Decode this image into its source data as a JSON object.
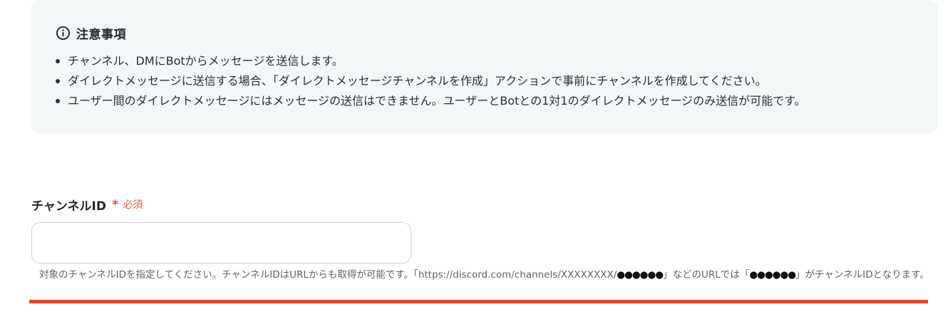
{
  "notice": {
    "title": "注意事項",
    "icon": "info-circle-icon",
    "items": [
      "チャンネル、DMにBotからメッセージを送信します。",
      "ダイレクトメッセージに送信する場合、「ダイレクトメッセージチャンネルを作成」アクションで事前にチャンネルを作成してください。",
      "ユーザー間のダイレクトメッセージにはメッセージの送信はできません。ユーザーとBotとの1対1のダイレクトメッセージのみ送信が可能です。"
    ]
  },
  "field": {
    "label": "チャンネルID",
    "required_star": "*",
    "required_text": "必須",
    "value": "",
    "help_part1": "対象のチャンネルIDを指定してください。チャンネルIDはURLからも取得が可能です。「https://discord.com/channels/XXXXXXXX/",
    "help_dots": "●●●●●●",
    "help_part2": "」などのURLでは「",
    "help_part3": "」がチャンネルIDとなります。"
  },
  "colors": {
    "notice_bg": "#f3f7f7",
    "required": "#e0564a",
    "error_bar": "#e2472f"
  }
}
